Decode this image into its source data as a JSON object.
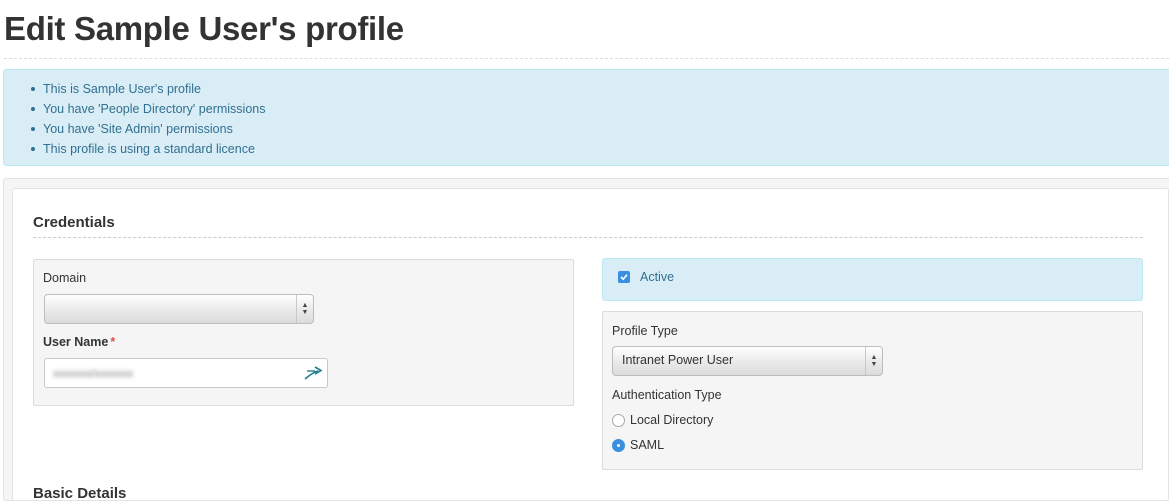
{
  "page": {
    "title": "Edit Sample User's profile"
  },
  "info": {
    "items": [
      "This is Sample User's profile",
      "You have 'People Directory' permissions",
      "You have 'Site Admin' permissions",
      "This profile is using a standard licence"
    ],
    "colors": {
      "background": "#d9edf7",
      "text": "#31708f"
    }
  },
  "credentials": {
    "title": "Credentials",
    "domain": {
      "label": "Domain",
      "value": ""
    },
    "username": {
      "label": "User Name",
      "required_mark": "*",
      "value": "xxxxxxx/xxxxxxx",
      "icon": "arrow-sign-in-icon"
    },
    "active": {
      "label": "Active",
      "checked": true
    },
    "profile_type": {
      "label": "Profile Type",
      "value": "Intranet Power User"
    },
    "auth_type": {
      "label": "Authentication Type",
      "options": [
        {
          "label": "Local Directory",
          "checked": false
        },
        {
          "label": "SAML",
          "checked": true
        }
      ]
    }
  },
  "next_section": {
    "title": "Basic Details"
  },
  "accent_color": "#3b8fe0"
}
